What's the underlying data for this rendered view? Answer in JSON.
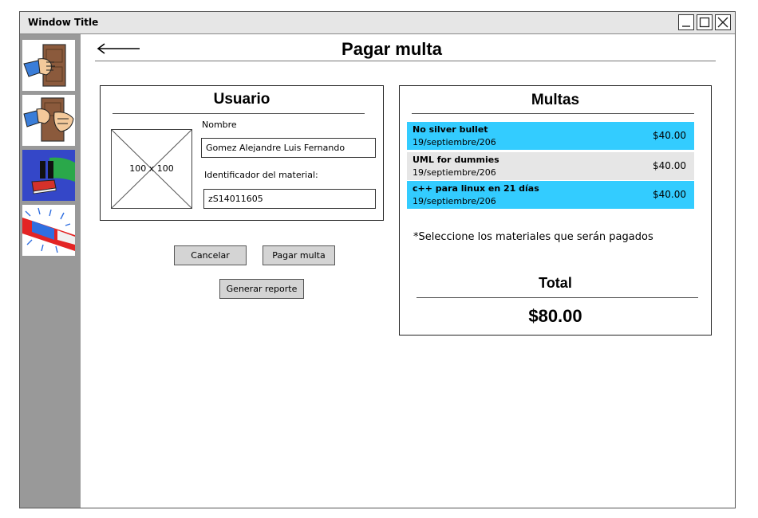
{
  "window": {
    "title": "Window Title"
  },
  "colors": {
    "sidebar": "#999999",
    "row_highlight": "#33ccff",
    "row_plain": "#e6e6e6",
    "button": "#d4d4d4"
  },
  "sidebar": {
    "items": [
      {
        "icon": "hand-knocking-door-icon"
      },
      {
        "icon": "two-hands-door-icon"
      },
      {
        "icon": "pause-book-icon"
      },
      {
        "icon": "police-siren-icon"
      }
    ]
  },
  "header": {
    "back_icon": "back-arrow-icon",
    "title": "Pagar multa"
  },
  "user_panel": {
    "title": "Usuario",
    "image_placeholder": "100 x 100",
    "name_label": "Nombre",
    "name_value": "Gomez Alejandre Luis Fernando",
    "material_label": "Identificador del material:",
    "material_value": "zS14011605"
  },
  "actions": {
    "cancel": "Cancelar",
    "pay": "Pagar multa",
    "report": "Generar reporte"
  },
  "fines_panel": {
    "title": "Multas",
    "rows": [
      {
        "name": "No silver bullet",
        "date": "19/septiembre/206",
        "amount": "$40.00",
        "selected": true
      },
      {
        "name": "UML for dummies",
        "date": "19/septiembre/206",
        "amount": "$40.00",
        "selected": false
      },
      {
        "name": "c++ para linux en 21 días",
        "date": "19/septiembre/206",
        "amount": "$40.00",
        "selected": true
      }
    ],
    "note": "*Seleccione los materiales que serán pagados",
    "total_label": "Total",
    "total_value": "$80.00"
  }
}
